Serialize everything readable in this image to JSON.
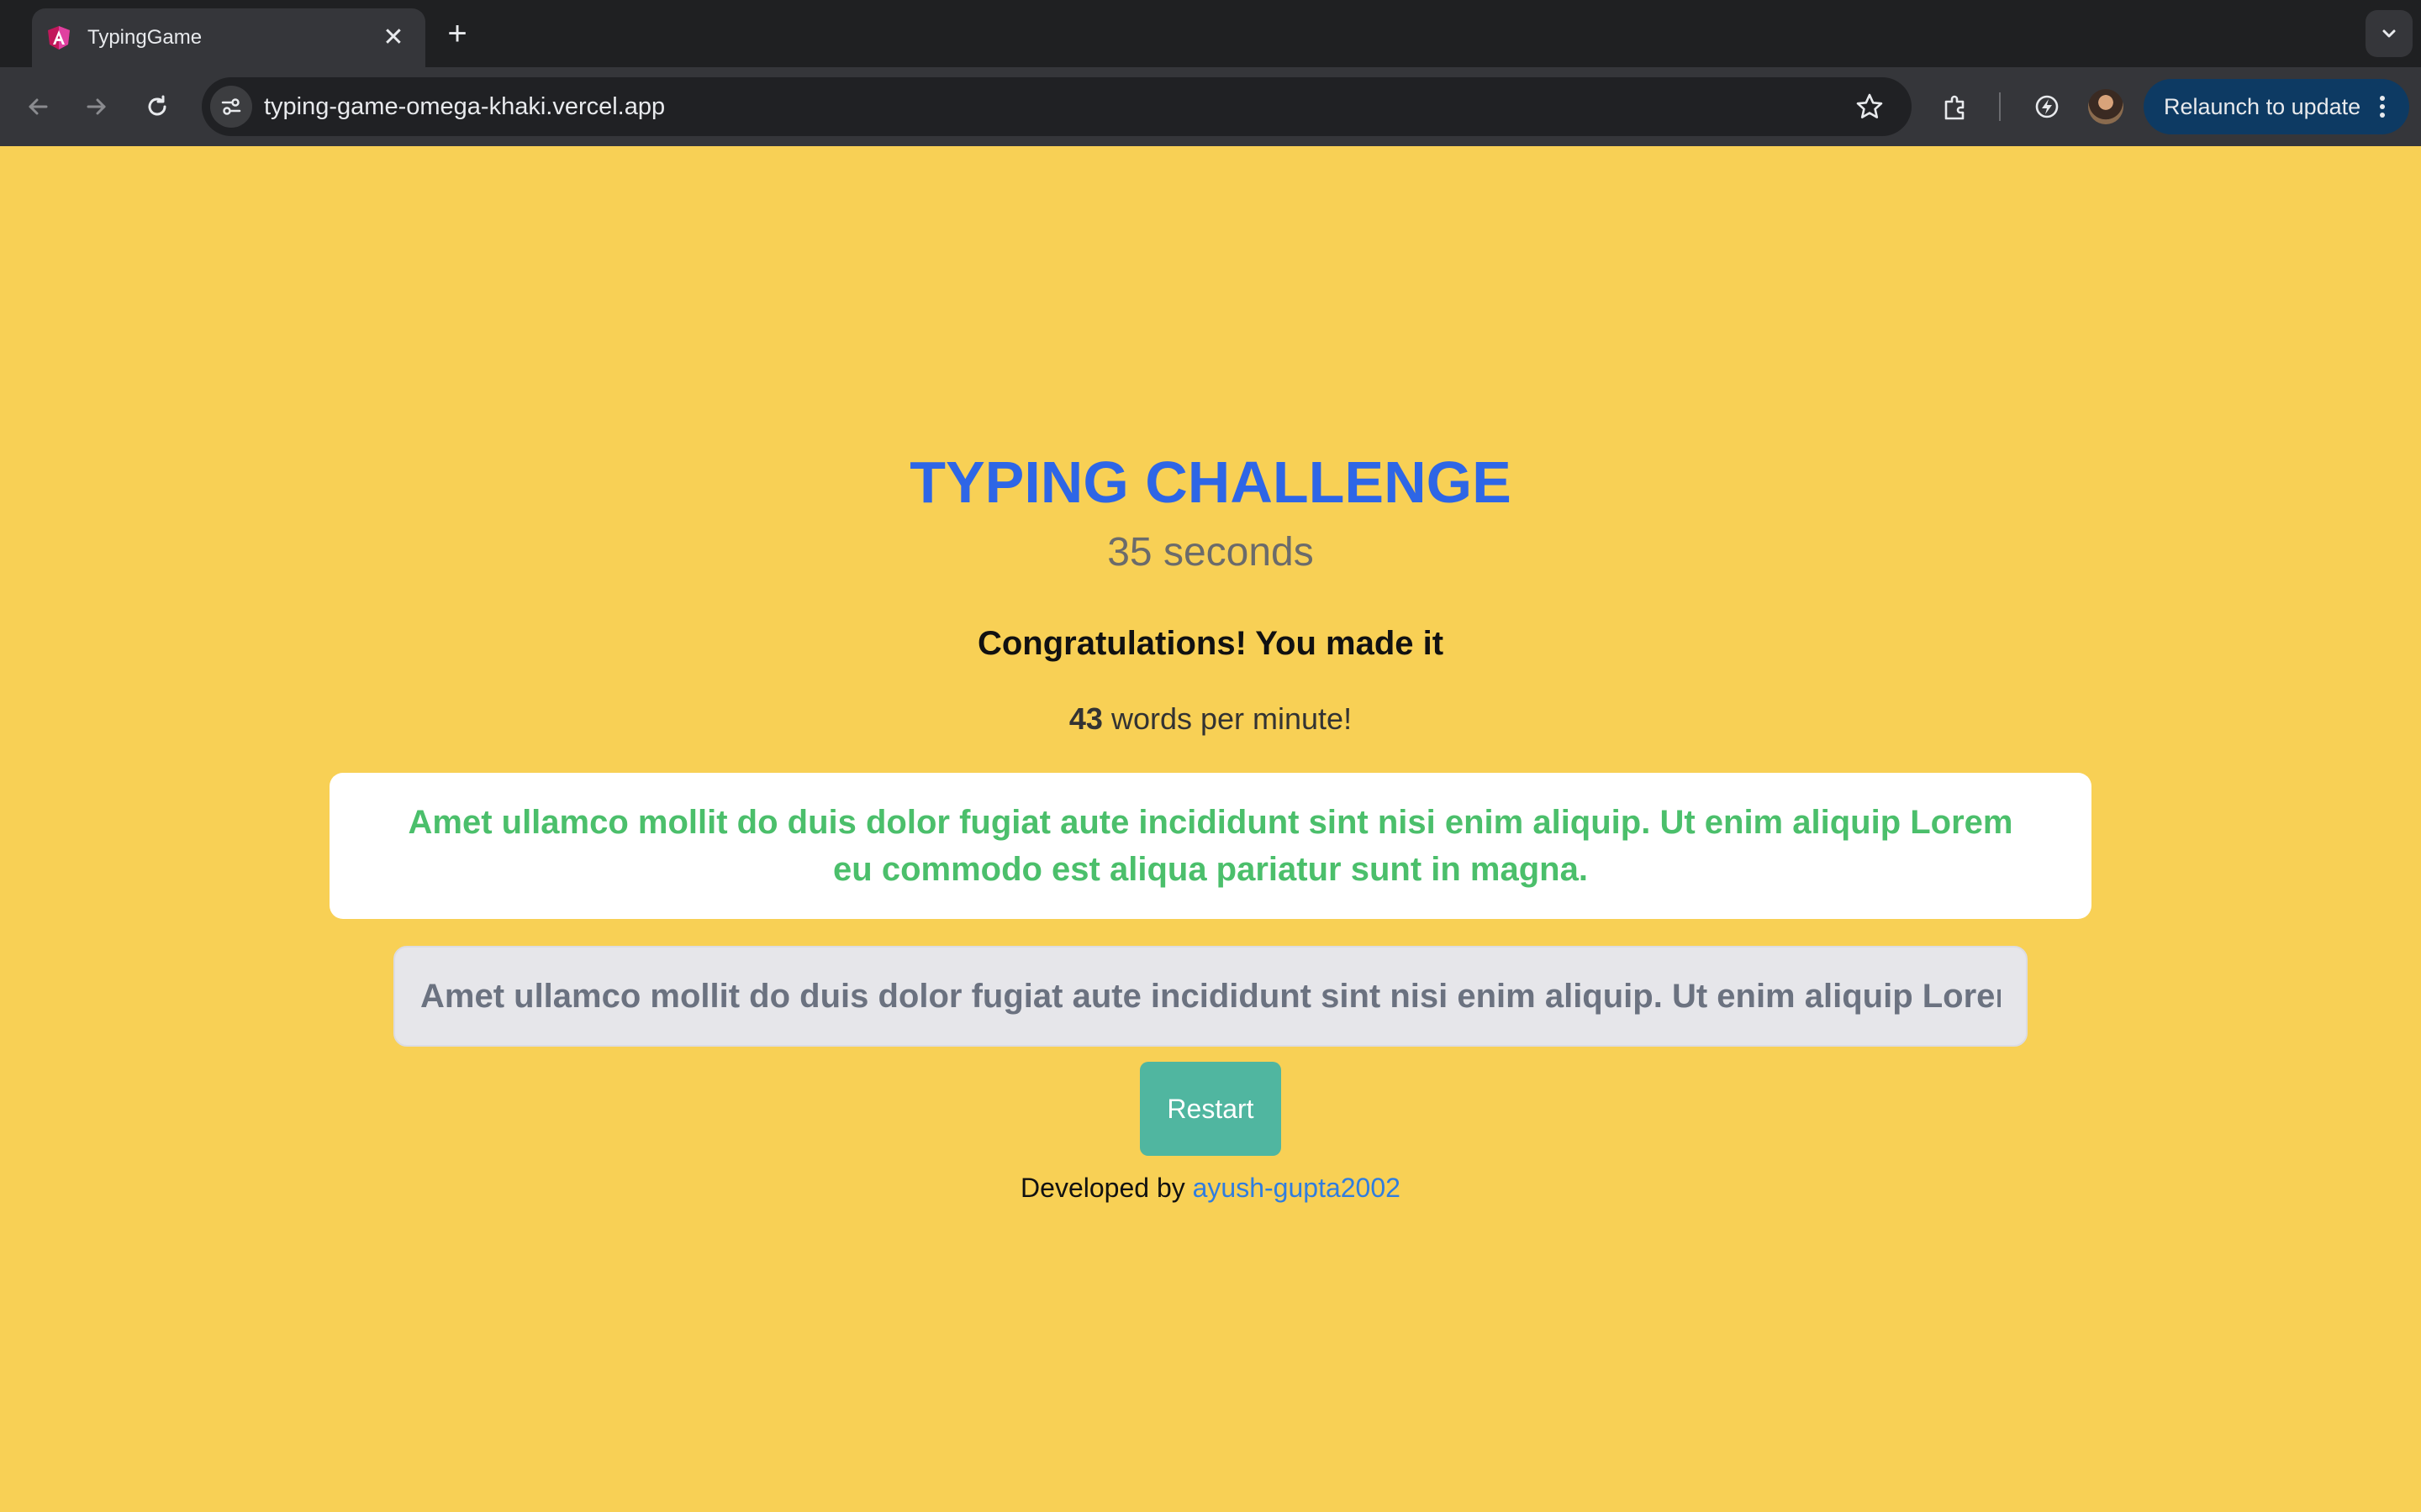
{
  "browser": {
    "tab_title": "TypingGame",
    "url": "typing-game-omega-khaki.vercel.app",
    "relaunch_label": "Relaunch to update"
  },
  "game": {
    "title": "TYPING CHALLENGE",
    "seconds_text": "35 seconds",
    "congrats_text": "Congratulations! You made it",
    "wpm_value": "43",
    "wpm_suffix": " words per minute!",
    "passage": "Amet ullamco mollit do duis dolor fugiat aute incididunt sint nisi enim aliquip. Ut enim aliquip Lorem eu commodo est aliqua pariatur sunt in magna.",
    "typed_value": "Amet ullamco mollit do duis dolor fugiat aute incididunt sint nisi enim aliquip. Ut enim aliquip Lorem eu commodo est aliqua pariatur sunt in magna.",
    "restart_label": "Restart",
    "footer_prefix": "Developed by ",
    "footer_link": "ayush-gupta2002"
  },
  "colors": {
    "page_bg": "#f8d055",
    "title": "#2e66e6",
    "passage_correct": "#4bbf6b",
    "restart_bg": "#50b6a0",
    "link": "#2f7de0"
  }
}
